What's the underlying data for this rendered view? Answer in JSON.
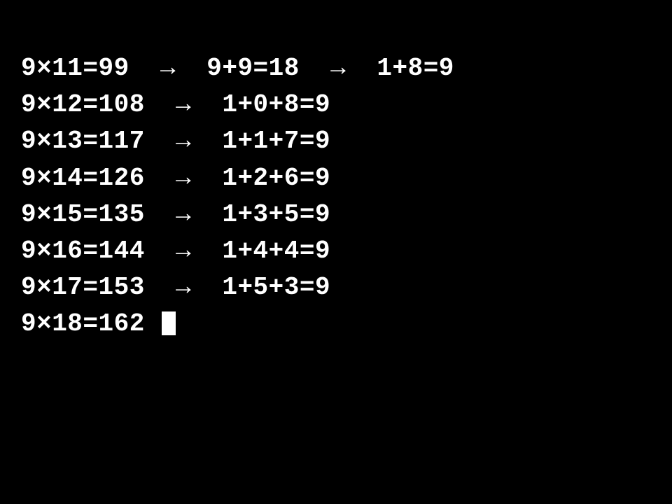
{
  "terminal": {
    "lines": [
      "9×11=99  →  9+9=18  →  1+8=9",
      "9×12=108  →  1+0+8=9",
      "9×13=117  →  1+1+7=9",
      "9×14=126  →  1+2+6=9",
      "9×15=135  →  1+3+5=9",
      "9×16=144  →  1+4+4=9",
      "9×17=153  →  1+5+3=9"
    ],
    "current_line": "9×18=162 "
  }
}
